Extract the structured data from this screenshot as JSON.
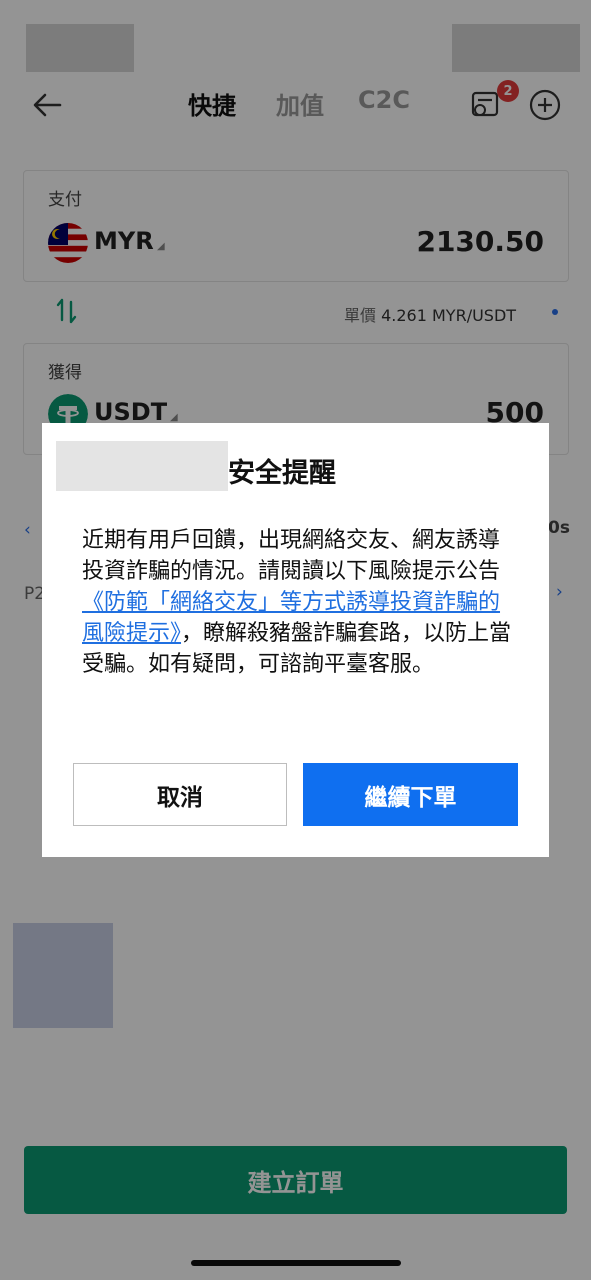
{
  "header": {
    "tabs": [
      {
        "label": "快捷",
        "active": true
      },
      {
        "label": "加值",
        "active": false
      },
      {
        "label": "C2C",
        "active": false
      }
    ],
    "orders_badge": "2"
  },
  "pay": {
    "label": "支付",
    "currency": "MYR",
    "amount": "2130.50"
  },
  "price": {
    "label": "單價",
    "value": "4.261 MYR/USDT"
  },
  "receive": {
    "label": "獲得",
    "currency": "USDT",
    "amount": "500"
  },
  "background_peek": {
    "left_text": "P2",
    "right_text": "0s"
  },
  "dialog": {
    "title": "安全提醒",
    "body_before_link": "近期有用戶回饋，出現網絡交友、網友誘導投資詐騙的情況。請閱讀以下風險提示公告",
    "link_text": "《防範「網絡交友」等方式誘導投資詐騙的風險提示》",
    "body_after_link": "，瞭解殺豬盤詐騙套路，以防上當受騙。如有疑問，可諮詢平臺客服。",
    "cancel_label": "取消",
    "continue_label": "繼續下單"
  },
  "footer": {
    "create_order_label": "建立訂單"
  },
  "colors": {
    "primary_green": "#0b9a73",
    "dialog_blue": "#0f6ff0",
    "link_blue": "#1f6fe0",
    "badge_red": "#e23b3b"
  },
  "icons": [
    "back-arrow-icon",
    "orders-icon",
    "plus-circle-icon",
    "malaysia-flag-icon",
    "tether-icon",
    "swap-icon"
  ]
}
